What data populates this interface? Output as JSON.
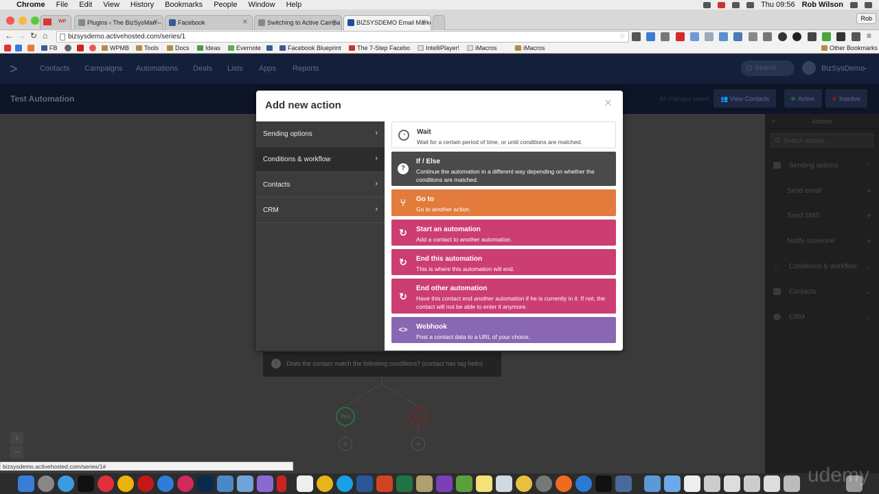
{
  "menubar": {
    "app": "Chrome",
    "items": [
      "File",
      "Edit",
      "View",
      "History",
      "Bookmarks",
      "People",
      "Window",
      "Help"
    ],
    "time": "Thu 09:56",
    "user": "Rob Wilson"
  },
  "browser": {
    "tabs": [
      "Plugins ‹ The BizSysMan –",
      "Facebook",
      "Switching to Active Campa",
      "BIZSYSDEMO Email Marke"
    ],
    "profile": "Rob",
    "url": "bizsysdemo.activehosted.com/series/1"
  },
  "bookmarks": [
    "FB",
    "WPMB",
    "Tools",
    "Docs",
    "Ideas",
    "Evernote",
    "Facebook Blueprint",
    "The 7-Step Facebo",
    "IntelliPlayer!",
    "iMacros",
    "iMacros",
    "Other Bookmarks"
  ],
  "appnav": {
    "links": [
      "Contacts",
      "Campaigns",
      "Automations",
      "Deals",
      "Lists",
      "Apps",
      "Reports"
    ],
    "search_placeholder": "Search",
    "user": "BizSysDemo"
  },
  "automation": {
    "title": "Test Automation",
    "saved_status": "All changes saved",
    "view_contacts": "View Contacts",
    "active_label": "Active",
    "inactive_label": "Inactive",
    "condition_text": "Does the contact match the following conditions? (contact has tag hello)",
    "yes": "Yes",
    "no": "No",
    "zoom_in": "+",
    "zoom_out": "−"
  },
  "actions_panel": {
    "header": "Actions",
    "search_placeholder": "Search actions...",
    "sections": [
      {
        "label": "Sending options"
      },
      {
        "label": "Send email"
      },
      {
        "label": "Send SMS"
      },
      {
        "label": "Notify someone"
      },
      {
        "label": "Conditions & workflow"
      },
      {
        "label": "Contacts"
      },
      {
        "label": "CRM"
      }
    ]
  },
  "modal": {
    "title": "Add new action",
    "close": "×",
    "sidebar": [
      {
        "label": "Sending options"
      },
      {
        "label": "Conditions & workflow"
      },
      {
        "label": "Contacts"
      },
      {
        "label": "CRM"
      }
    ],
    "cards": [
      {
        "title": "Wait",
        "desc": "Wait for a certain period of time, or until conditions are matched.",
        "color": "#ffffff",
        "icon": "clock-icon"
      },
      {
        "title": "If / Else",
        "desc": "Continue the automation in a different way depending on whether the conditions are matched.",
        "color": "#4a4a4a",
        "icon": "question-icon"
      },
      {
        "title": "Go to",
        "desc": "Go to another action.",
        "color": "#e37b3c",
        "icon": "branch-icon"
      },
      {
        "title": "Start an automation",
        "desc": "Add a contact to another automation.",
        "color": "#cc3d72",
        "icon": "refresh-icon"
      },
      {
        "title": "End this automation",
        "desc": "This is where this automation will end.",
        "color": "#cc3d72",
        "icon": "refresh-icon"
      },
      {
        "title": "End other automation",
        "desc": "Have this contact end another automation if he is currently in it. If not, the contact will not be able to enter it anymore.",
        "color": "#cc3d72",
        "icon": "refresh-icon"
      },
      {
        "title": "Webhook",
        "desc": "Post a contact data to a URL of your choice.",
        "color": "#8a67b2",
        "icon": "code-icon"
      }
    ]
  },
  "statusbar": "bizsysdemo.activehosted.com/series/1#",
  "watermark": "udemy"
}
